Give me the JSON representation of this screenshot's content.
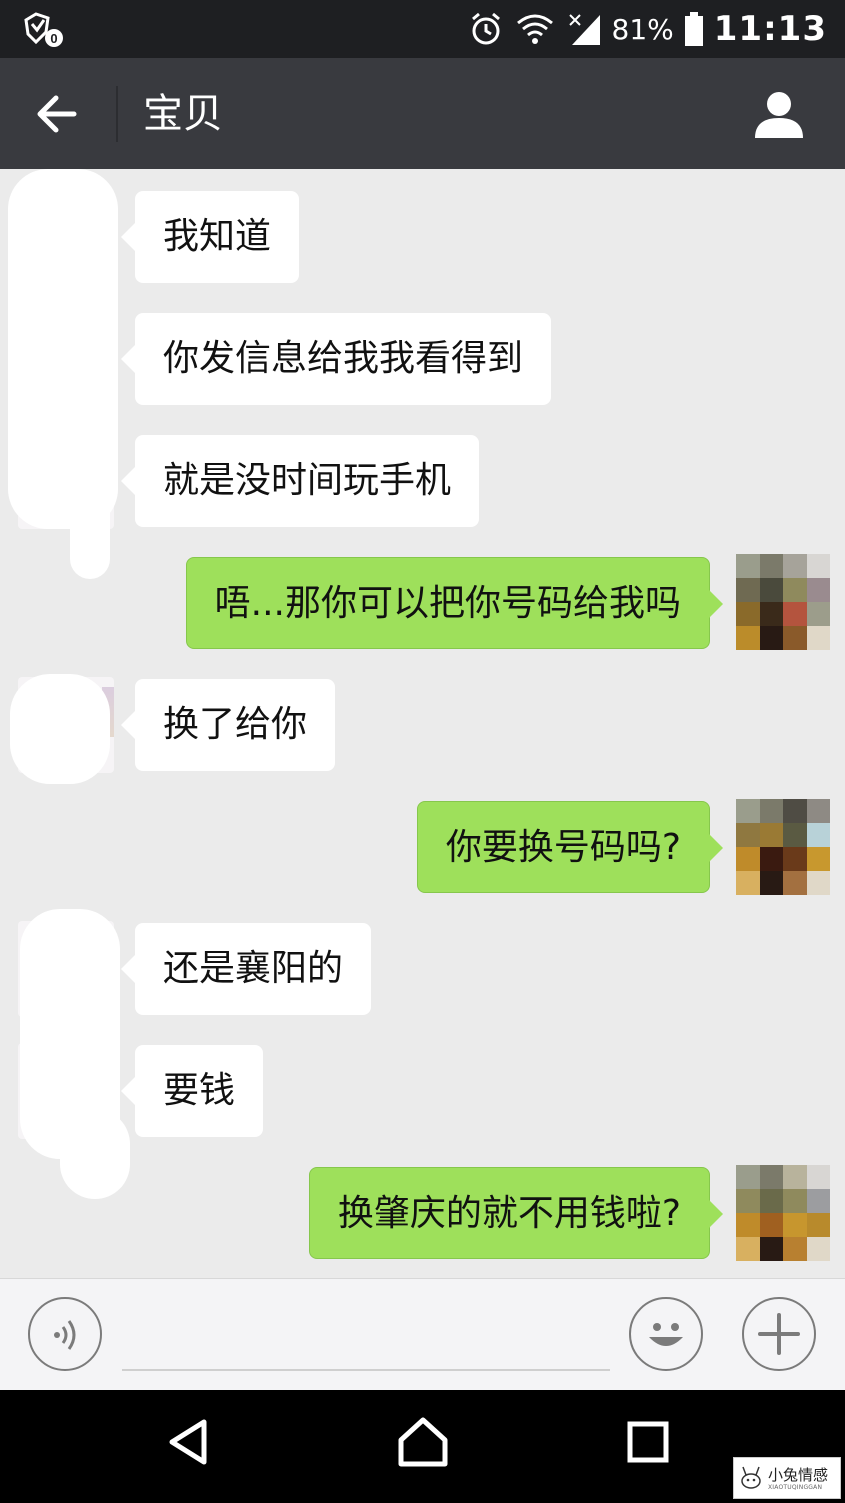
{
  "status_bar": {
    "battery_percent": "81%",
    "time": "11:13",
    "icons": [
      "shield-icon",
      "alarm-icon",
      "wifi-icon",
      "signal-icon",
      "battery-icon"
    ]
  },
  "header": {
    "title": "宝贝",
    "back_icon": "arrow-left-icon",
    "profile_icon": "person-icon"
  },
  "messages": [
    {
      "side": "in",
      "text": "我知道"
    },
    {
      "side": "in",
      "text": "你发信息给我我看得到"
    },
    {
      "side": "in",
      "text": "就是没时间玩手机"
    },
    {
      "side": "out",
      "text": "唔...那你可以把你号码给我吗"
    },
    {
      "side": "in",
      "text": "换了给你"
    },
    {
      "side": "out",
      "text": "你要换号码吗?"
    },
    {
      "side": "in",
      "text": "还是襄阳的"
    },
    {
      "side": "in",
      "text": "要钱"
    },
    {
      "side": "out",
      "text": "换肇庆的就不用钱啦?"
    }
  ],
  "input_bar": {
    "voice_icon": "voice-icon",
    "emoji_icon": "emoji-icon",
    "plus_icon": "plus-icon"
  },
  "nav_bar": {
    "icons": [
      "nav-back-icon",
      "nav-home-icon",
      "nav-recents-icon"
    ]
  },
  "watermark": {
    "text": "小兔情感",
    "sub": "XIAOTUQINGGAN"
  },
  "colors": {
    "status_bar": "#1e1f22",
    "title_bar": "#393a3f",
    "chat_bg": "#ebebeb",
    "bubble_out": "#9ee05b",
    "bubble_in": "#ffffff"
  }
}
